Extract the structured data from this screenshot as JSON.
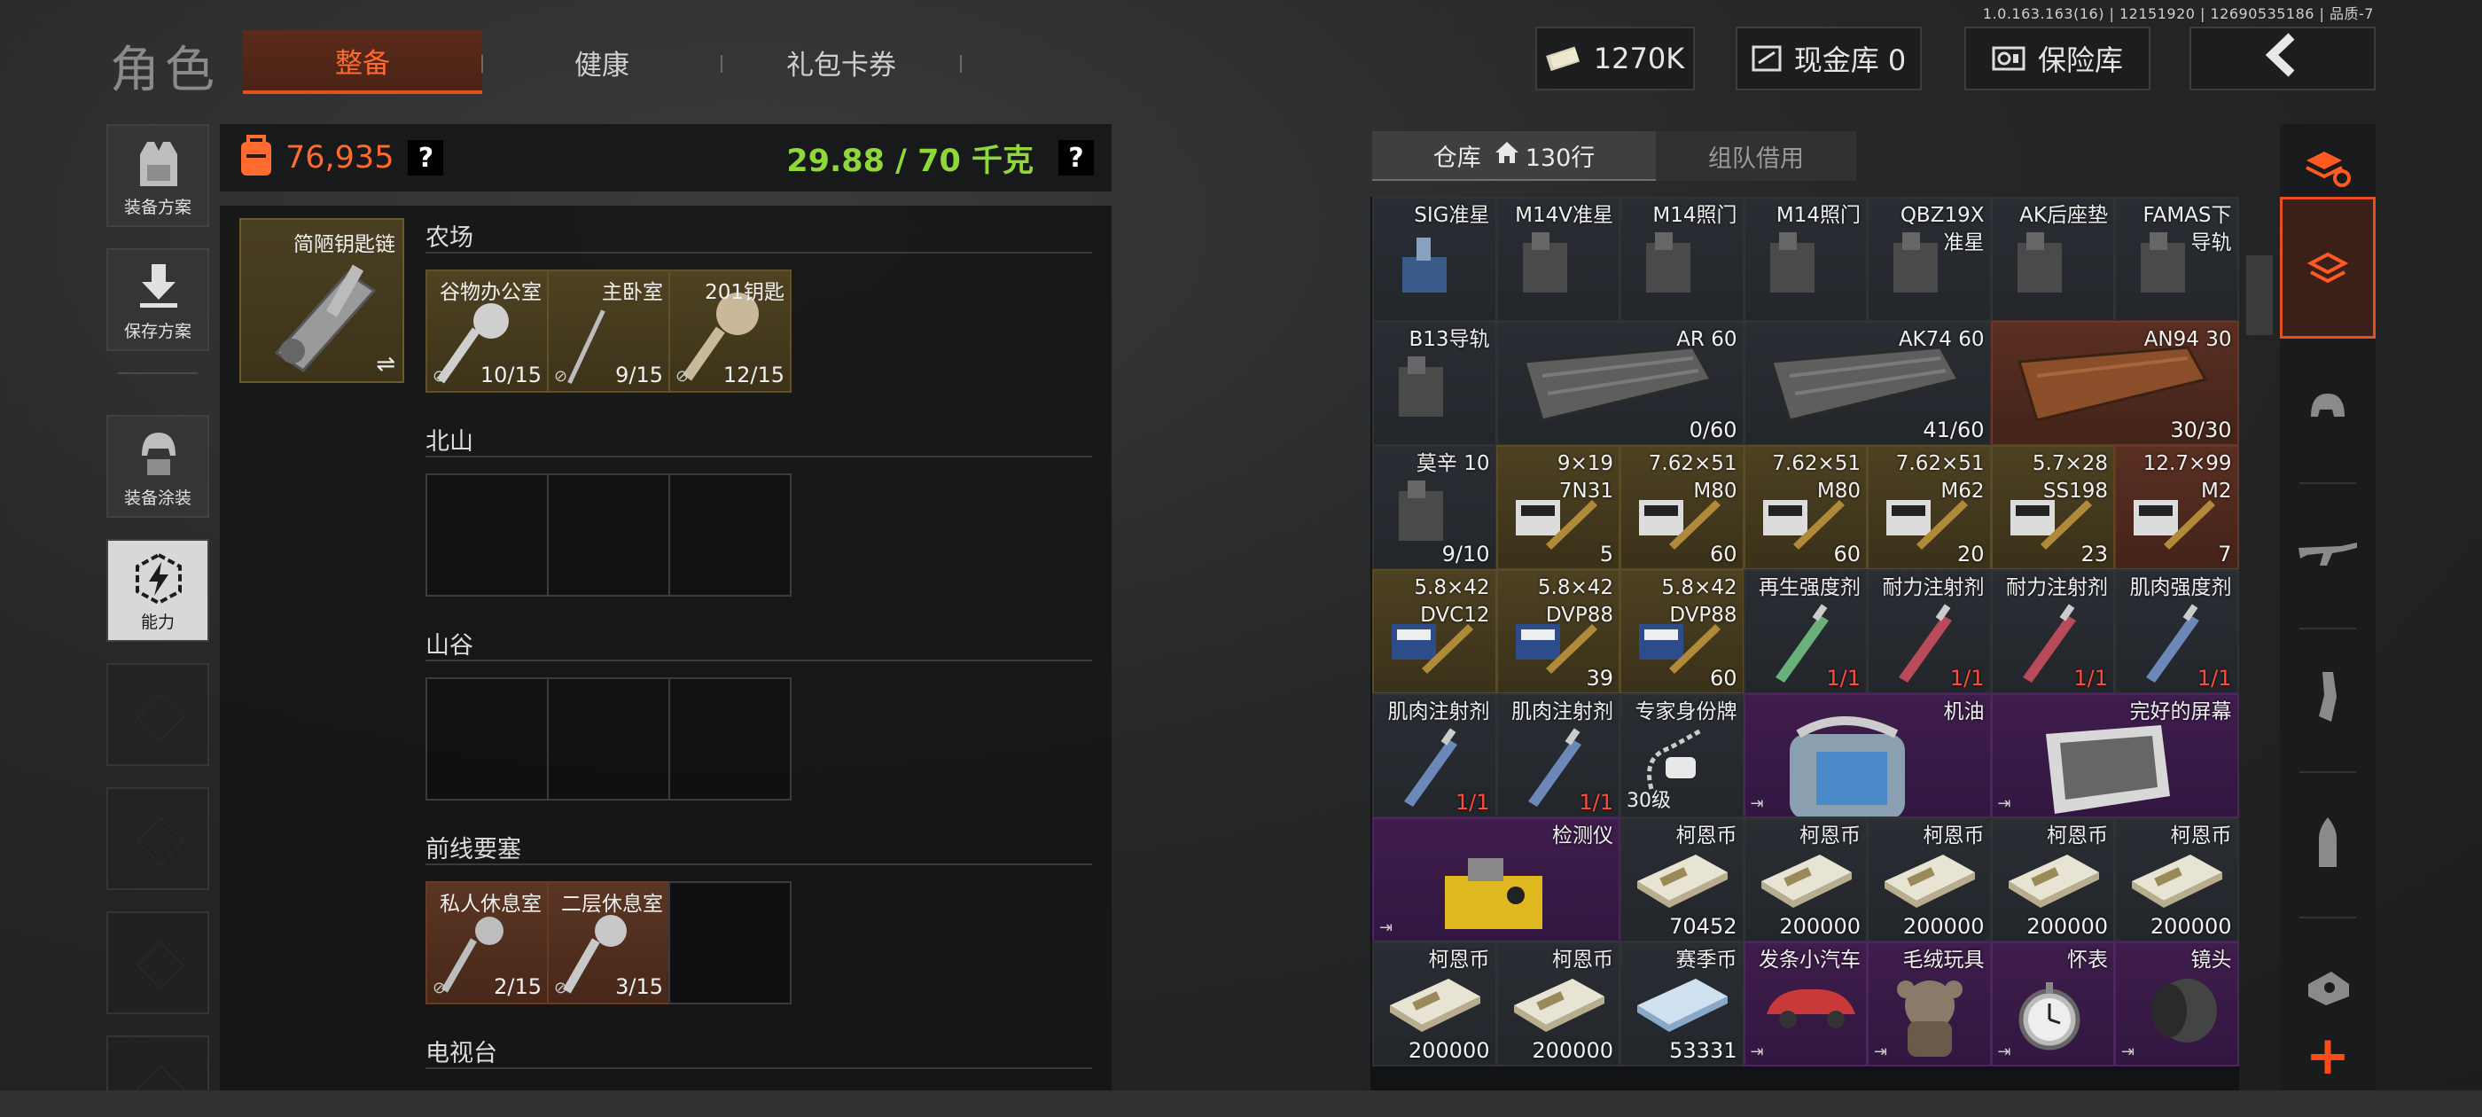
{
  "version": "1.0.163.163(16) | 12151920 | 12690535186 | 品质-7",
  "page_title": "角色",
  "tabs": [
    {
      "label": "整备",
      "active": true
    },
    {
      "label": "健康",
      "active": false
    },
    {
      "label": "礼包卡券",
      "active": false
    }
  ],
  "top_buttons": {
    "money": "1270K",
    "cash_vault": "现金库 0",
    "insurance": "保险库"
  },
  "left_nav": [
    {
      "label": "装备方案"
    },
    {
      "label": "保存方案"
    },
    {
      "label": "装备涂装"
    },
    {
      "label": "能力"
    }
  ],
  "header": {
    "value": "76,935",
    "weight": "29.88 / 70 千克",
    "help": "?"
  },
  "keychain": {
    "label": "简陋钥匙链",
    "swap": "⇌"
  },
  "key_sections": [
    {
      "title": "农场",
      "slots": [
        {
          "name": "谷物办公室",
          "count": "10/15",
          "style": "gold"
        },
        {
          "name": "主卧室",
          "count": "9/15",
          "style": "gold"
        },
        {
          "name": "201钥匙",
          "count": "12/15",
          "style": "gold"
        }
      ]
    },
    {
      "title": "北山",
      "slots": [
        {},
        {},
        {}
      ]
    },
    {
      "title": "山谷",
      "slots": [
        {},
        {},
        {}
      ]
    },
    {
      "title": "前线要塞",
      "slots": [
        {
          "name": "私人休息室",
          "count": "2/15",
          "style": "rust"
        },
        {
          "name": "二层休息室",
          "count": "3/15",
          "style": "rust"
        },
        {}
      ]
    },
    {
      "title": "电视台",
      "slots": []
    }
  ],
  "storage_tabs": {
    "warehouse": "仓库",
    "rows": "130行",
    "team": "组队借用"
  },
  "items": [
    {
      "name": "SIG准星",
      "count": "",
      "style": "blue"
    },
    {
      "name": "M14V准星",
      "count": "",
      "style": "blue"
    },
    {
      "name": "M14照门",
      "count": "",
      "style": "blue"
    },
    {
      "name": "M14照门",
      "count": "",
      "style": "blue"
    },
    {
      "name": "QBZ19X\n准星",
      "count": "",
      "style": "blue"
    },
    {
      "name": "AK后座垫",
      "count": "",
      "style": "blue"
    },
    {
      "name": "FAMAS下\n导轨",
      "count": "",
      "style": "blue"
    },
    {
      "name": "B13导轨",
      "count": "",
      "style": "blue"
    },
    {
      "name": "AR 60",
      "count": "0/60",
      "style": "blue"
    },
    {
      "name": "AK74 60",
      "count": "41/60",
      "style": "blue"
    },
    {
      "name": "AN94 30",
      "count": "30/30",
      "style": "rust"
    },
    {
      "name": "莫辛 10",
      "count": "9/10",
      "style": "blue"
    },
    {
      "name": "9×19\n7N31",
      "count": "5",
      "style": "gold"
    },
    {
      "name": "7.62×51\nM80",
      "count": "60",
      "style": "gold"
    },
    {
      "name": "7.62×51\nM80",
      "count": "60",
      "style": "gold"
    },
    {
      "name": "7.62×51\nM62",
      "count": "20",
      "style": "gold"
    },
    {
      "name": "5.7×28\nSS198",
      "count": "23",
      "style": "gold"
    },
    {
      "name": "12.7×99\nM2",
      "count": "7",
      "style": "rust"
    },
    {
      "name": "5.8×42\nDVC12",
      "count": "",
      "style": "gold"
    },
    {
      "name": "5.8×42\nDVP88",
      "count": "39",
      "style": "gold"
    },
    {
      "name": "5.8×42\nDVP88",
      "count": "60",
      "style": "gold"
    },
    {
      "name": "再生强度剂",
      "count": "1/1",
      "style": "blue"
    },
    {
      "name": "耐力注射剂",
      "count": "1/1",
      "style": "blue"
    },
    {
      "name": "耐力注射剂",
      "count": "1/1",
      "style": "blue"
    },
    {
      "name": "肌肉强度剂",
      "count": "1/1",
      "style": "blue"
    },
    {
      "name": "肌肉注射剂",
      "count": "1/1",
      "style": "blue"
    },
    {
      "name": "肌肉注射剂",
      "count": "1/1",
      "style": "blue"
    },
    {
      "name": "专家身份牌",
      "count": "",
      "level": "30级",
      "style": "blue"
    },
    {
      "name": "机油",
      "count": "",
      "style": "purple"
    },
    {
      "name": "完好的屏幕",
      "count": "",
      "style": "purple"
    },
    {
      "name": "检测仪",
      "count": "",
      "style": "purple"
    },
    {
      "name": "柯恩币",
      "count": "70452",
      "style": "blue"
    },
    {
      "name": "柯恩币",
      "count": "200000",
      "style": "blue"
    },
    {
      "name": "柯恩币",
      "count": "200000",
      "style": "blue"
    },
    {
      "name": "柯恩币",
      "count": "200000",
      "style": "blue"
    },
    {
      "name": "柯恩币",
      "count": "200000",
      "style": "blue"
    },
    {
      "name": "柯恩币",
      "count": "200000",
      "style": "blue"
    },
    {
      "name": "柯恩币",
      "count": "200000",
      "style": "blue"
    },
    {
      "name": "赛季币",
      "count": "53331",
      "style": "blue"
    },
    {
      "name": "发条小汽车",
      "count": "",
      "style": "purple"
    },
    {
      "name": "毛绒玩具",
      "count": "",
      "style": "purple"
    },
    {
      "name": "怀表",
      "count": "",
      "style": "purple"
    },
    {
      "name": "镜头",
      "count": "",
      "style": "purple"
    }
  ],
  "plus_label": "+",
  "colors": {
    "accent": "#e6501c",
    "weight_ok": "#8fd83a",
    "gold": "#4d4122",
    "purple": "#3f1d4c",
    "rust": "#5a2f22"
  }
}
